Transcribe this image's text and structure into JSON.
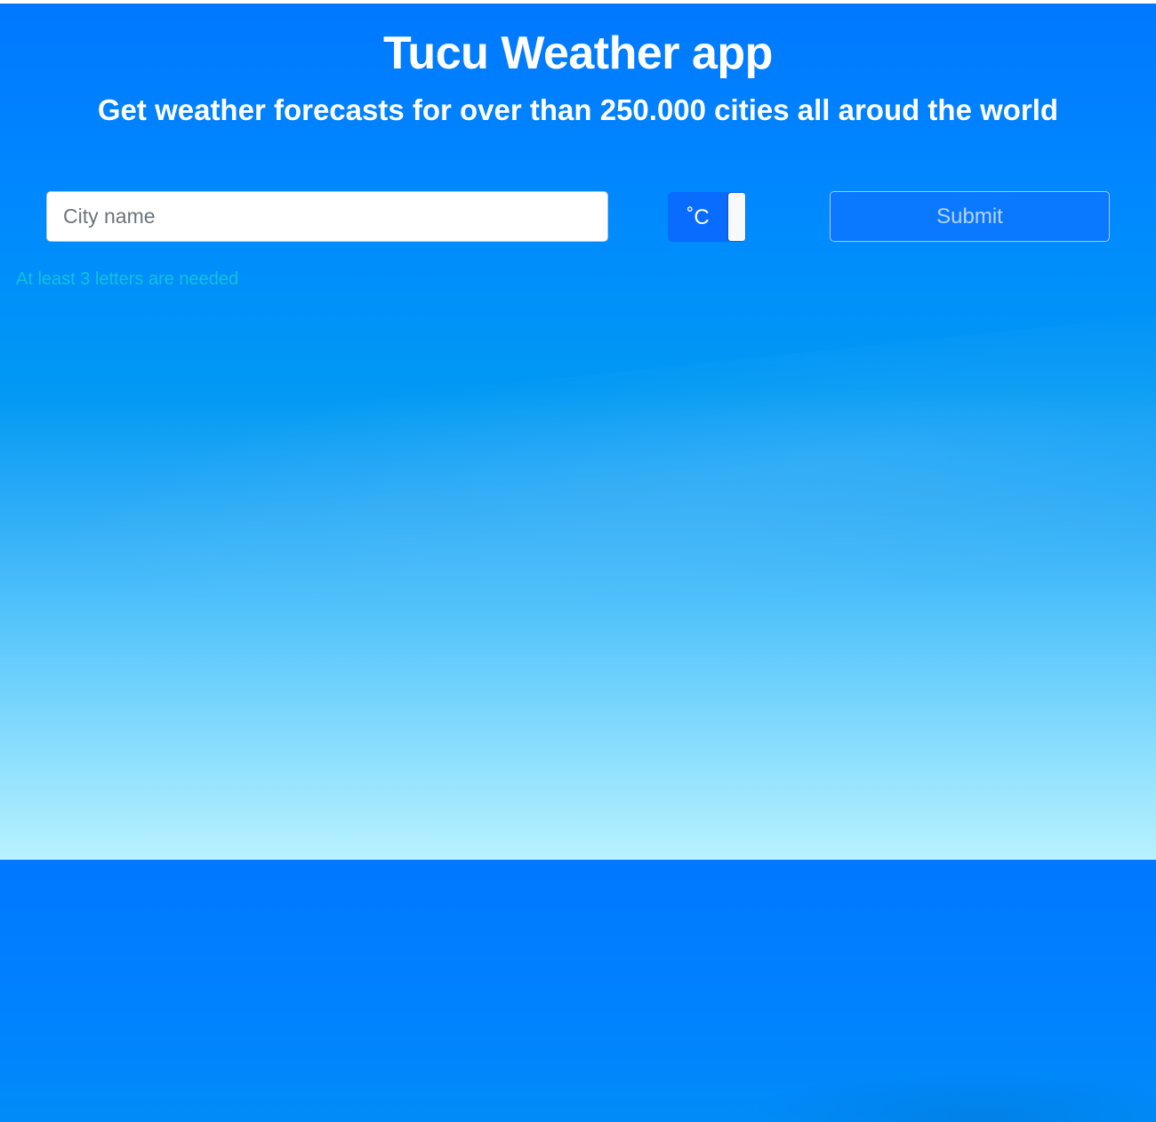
{
  "header": {
    "title": "Tucu Weather app",
    "subtitle": "Get weather forecasts for over than 250.000 cities all aroud the world"
  },
  "search": {
    "placeholder": "City name",
    "value": ""
  },
  "unit_toggle": {
    "label": "˚C"
  },
  "submit": {
    "label": "Submit"
  },
  "validation": {
    "message": "At least 3 letters are needed"
  },
  "colors": {
    "background_top": "#0078ff",
    "background_horizon": "#b8f2ff",
    "toggle": "#0a6cff",
    "submit_text": "#b6d4ff",
    "hint": "#13c1d9"
  }
}
